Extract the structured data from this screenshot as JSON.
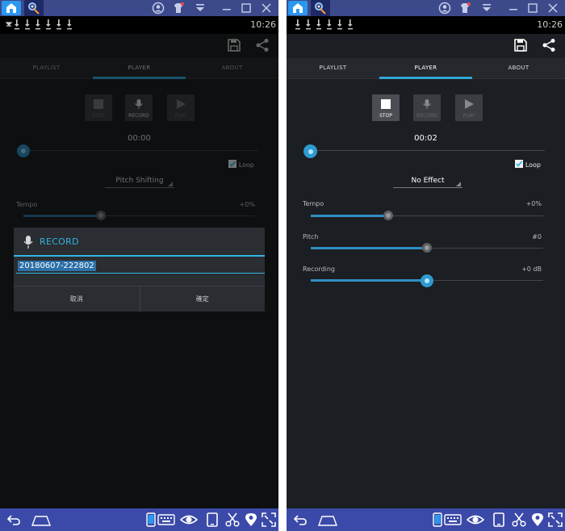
{
  "colors": {
    "accent": "#33b5e5",
    "emulator_bar": "#3c4a8c",
    "nav_bar": "#3b4aa8",
    "background": "#1b1e22"
  },
  "left": {
    "clock": "10:26",
    "tabs": [
      "PLAYLIST",
      "PLAYER",
      "ABOUT"
    ],
    "active_tab": "PLAYER",
    "transport": {
      "stop": "STOP",
      "record": "RECORD",
      "play": "PLAY"
    },
    "time": "00:00",
    "loop_label": "Loop",
    "effect": "Pitch Shifting",
    "tempo_label": "Tempo",
    "tempo_value": "+0%",
    "dialog": {
      "title": "RECORD",
      "filename": "20180607-222802",
      "cancel": "取消",
      "ok": "確定"
    }
  },
  "right": {
    "clock": "10:26",
    "tabs": [
      "PLAYLIST",
      "PLAYER",
      "ABOUT"
    ],
    "active_tab": "PLAYER",
    "transport": {
      "stop": "STOP",
      "record": "RECORD",
      "play": "PLAY"
    },
    "time": "00:02",
    "loop_label": "Loop",
    "effect": "No Effect",
    "params": [
      {
        "label": "Tempo",
        "value": "+0%"
      },
      {
        "label": "Pitch",
        "value": "#0"
      },
      {
        "label": "Recording",
        "value": "+0 dB"
      }
    ]
  }
}
